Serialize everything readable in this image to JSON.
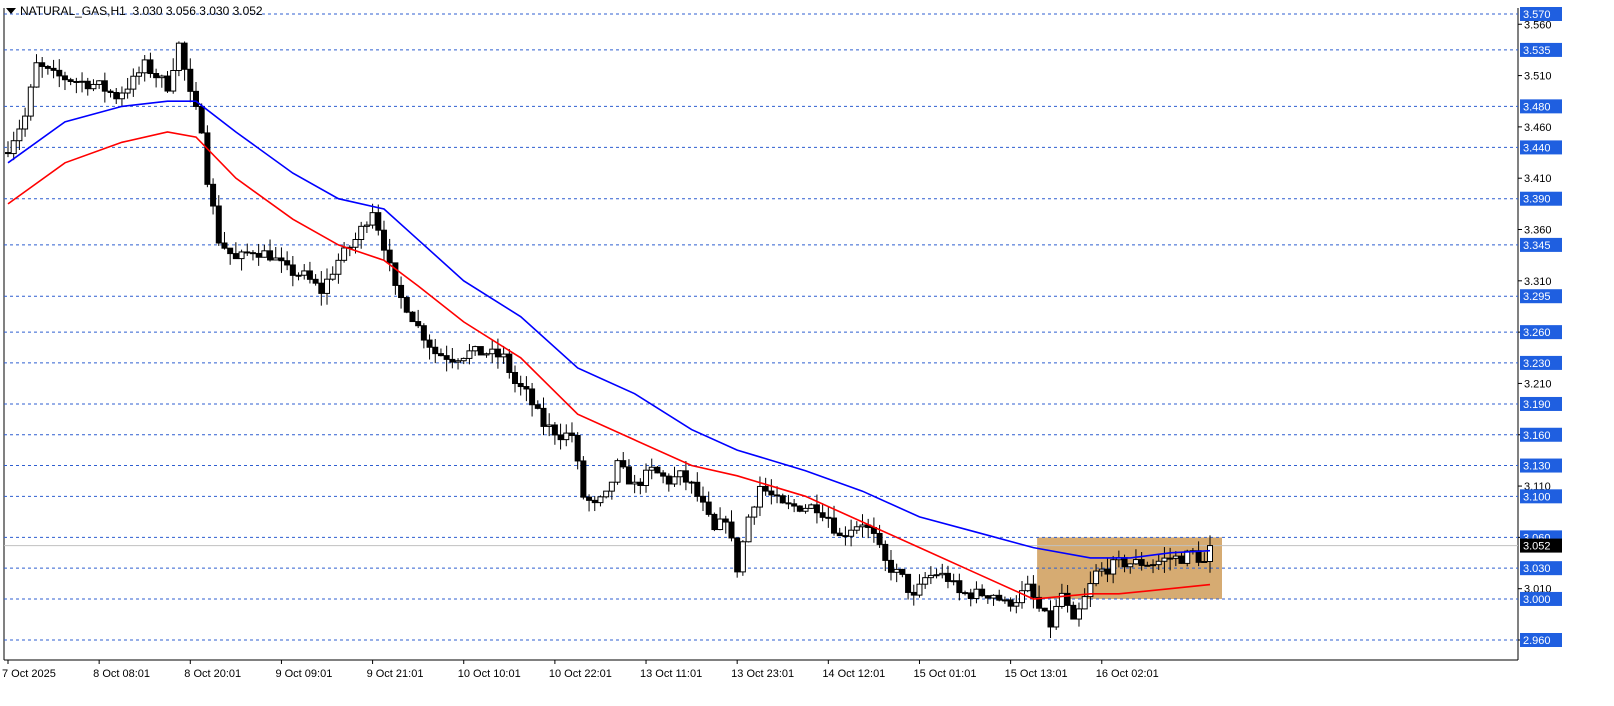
{
  "header": {
    "symbol": "NATURAL_GAS,H1",
    "ohlc": "3.030 3.056 3.030 3.052"
  },
  "colors": {
    "background": "#ffffff",
    "candle_body": "#000000",
    "level_lines": "#2f5fd0",
    "ma_fast": "#0000ff",
    "ma_slow": "#ff0000",
    "box_fill": "#d2a263",
    "current_price_line": "#c0c0c0",
    "price_tag_bg": "#1f5fe0",
    "last_price_tag_bg": "#000000"
  },
  "chart_data": {
    "type": "candlestick",
    "title": "NATURAL_GAS,H1",
    "ylim": [
      2.94,
      3.575
    ],
    "grid": false,
    "last_price": 3.052,
    "y_ticks": [
      "3.560",
      "3.510",
      "3.460",
      "3.410",
      "3.360",
      "3.310",
      "3.260",
      "3.210",
      "3.160",
      "3.110",
      "3.060",
      "3.010",
      "2.960"
    ],
    "horizontal_levels": [
      "3.570",
      "3.535",
      "3.480",
      "3.440",
      "3.390",
      "3.345",
      "3.295",
      "3.260",
      "3.230",
      "3.190",
      "3.160",
      "3.130",
      "3.100",
      "3.060",
      "3.030",
      "3.000",
      "2.960"
    ],
    "x_tick_labels": [
      "7 Oct 2025",
      "8 Oct 08:01",
      "8 Oct 20:01",
      "9 Oct 09:01",
      "9 Oct 21:01",
      "10 Oct 10:01",
      "10 Oct 22:01",
      "13 Oct 11:01",
      "13 Oct 23:01",
      "14 Oct 12:01",
      "15 Oct 01:01",
      "15 Oct 13:01",
      "16 Oct 02:01"
    ],
    "candle_anchors": [
      [
        0,
        3.44
      ],
      [
        3,
        3.47
      ],
      [
        5,
        3.52
      ],
      [
        8,
        3.51
      ],
      [
        12,
        3.505
      ],
      [
        16,
        3.5
      ],
      [
        19,
        3.49
      ],
      [
        22,
        3.505
      ],
      [
        24,
        3.52
      ],
      [
        26,
        3.51
      ],
      [
        28,
        3.5
      ],
      [
        30,
        3.54
      ],
      [
        32,
        3.49
      ],
      [
        34,
        3.46
      ],
      [
        35,
        3.41
      ],
      [
        37,
        3.35
      ],
      [
        40,
        3.33
      ],
      [
        43,
        3.34
      ],
      [
        46,
        3.335
      ],
      [
        49,
        3.32
      ],
      [
        52,
        3.315
      ],
      [
        55,
        3.3
      ],
      [
        58,
        3.33
      ],
      [
        61,
        3.35
      ],
      [
        64,
        3.38
      ],
      [
        66,
        3.345
      ],
      [
        68,
        3.3
      ],
      [
        70,
        3.285
      ],
      [
        72,
        3.265
      ],
      [
        75,
        3.24
      ],
      [
        78,
        3.235
      ],
      [
        81,
        3.24
      ],
      [
        84,
        3.24
      ],
      [
        87,
        3.235
      ],
      [
        89,
        3.21
      ],
      [
        91,
        3.2
      ],
      [
        94,
        3.17
      ],
      [
        97,
        3.16
      ],
      [
        99,
        3.16
      ],
      [
        101,
        3.1
      ],
      [
        103,
        3.09
      ],
      [
        105,
        3.1
      ],
      [
        107,
        3.13
      ],
      [
        110,
        3.11
      ],
      [
        113,
        3.125
      ],
      [
        116,
        3.115
      ],
      [
        118,
        3.12
      ],
      [
        120,
        3.11
      ],
      [
        122,
        3.09
      ],
      [
        124,
        3.065
      ],
      [
        126,
        3.08
      ],
      [
        128,
        3.03
      ],
      [
        130,
        3.08
      ],
      [
        132,
        3.11
      ],
      [
        134,
        3.1
      ],
      [
        136,
        3.09
      ],
      [
        139,
        3.09
      ],
      [
        142,
        3.09
      ],
      [
        144,
        3.08
      ],
      [
        146,
        3.06
      ],
      [
        148,
        3.07
      ],
      [
        150,
        3.075
      ],
      [
        152,
        3.06
      ],
      [
        154,
        3.035
      ],
      [
        157,
        3.02
      ],
      [
        159,
        3.0
      ],
      [
        161,
        3.02
      ],
      [
        163,
        3.025
      ],
      [
        165,
        3.02
      ],
      [
        167,
        3.005
      ],
      [
        170,
        3.005
      ],
      [
        173,
        3.005
      ],
      [
        175,
        2.995
      ],
      [
        177,
        3.0
      ],
      [
        179,
        3.01
      ],
      [
        181,
        2.99
      ],
      [
        183,
        2.975
      ],
      [
        185,
        3.005
      ],
      [
        187,
        2.975
      ],
      [
        189,
        3.0
      ],
      [
        191,
        3.025
      ],
      [
        193,
        3.03
      ],
      [
        195,
        3.035
      ],
      [
        198,
        3.035
      ],
      [
        201,
        3.035
      ],
      [
        204,
        3.04
      ],
      [
        206,
        3.04
      ],
      [
        208,
        3.045
      ],
      [
        210,
        3.035
      ],
      [
        211,
        3.052
      ]
    ],
    "volatility_note": "",
    "series": [
      {
        "type": "ma",
        "color": "#0000ff",
        "points": [
          [
            0,
            3.425
          ],
          [
            10,
            3.465
          ],
          [
            20,
            3.48
          ],
          [
            28,
            3.485
          ],
          [
            33,
            3.485
          ],
          [
            40,
            3.455
          ],
          [
            50,
            3.415
          ],
          [
            58,
            3.39
          ],
          [
            66,
            3.38
          ],
          [
            72,
            3.35
          ],
          [
            80,
            3.31
          ],
          [
            90,
            3.275
          ],
          [
            100,
            3.225
          ],
          [
            110,
            3.2
          ],
          [
            120,
            3.165
          ],
          [
            128,
            3.145
          ],
          [
            140,
            3.125
          ],
          [
            150,
            3.105
          ],
          [
            160,
            3.08
          ],
          [
            170,
            3.065
          ],
          [
            180,
            3.05
          ],
          [
            190,
            3.04
          ],
          [
            197,
            3.04
          ],
          [
            204,
            3.045
          ],
          [
            211,
            3.047
          ]
        ]
      },
      {
        "type": "ma",
        "color": "#ff0000",
        "points": [
          [
            0,
            3.385
          ],
          [
            10,
            3.425
          ],
          [
            20,
            3.445
          ],
          [
            28,
            3.455
          ],
          [
            33,
            3.45
          ],
          [
            40,
            3.41
          ],
          [
            50,
            3.37
          ],
          [
            58,
            3.345
          ],
          [
            66,
            3.33
          ],
          [
            72,
            3.305
          ],
          [
            80,
            3.27
          ],
          [
            90,
            3.235
          ],
          [
            100,
            3.18
          ],
          [
            110,
            3.155
          ],
          [
            120,
            3.13
          ],
          [
            128,
            3.12
          ],
          [
            140,
            3.1
          ],
          [
            150,
            3.075
          ],
          [
            160,
            3.05
          ],
          [
            170,
            3.025
          ],
          [
            180,
            3.0
          ],
          [
            190,
            3.005
          ],
          [
            195,
            3.005
          ],
          [
            204,
            3.01
          ],
          [
            211,
            3.014
          ]
        ]
      }
    ],
    "highlight_box": {
      "from_index": 181,
      "to_index": 211,
      "y_low": 3.0,
      "y_high": 3.06
    }
  }
}
